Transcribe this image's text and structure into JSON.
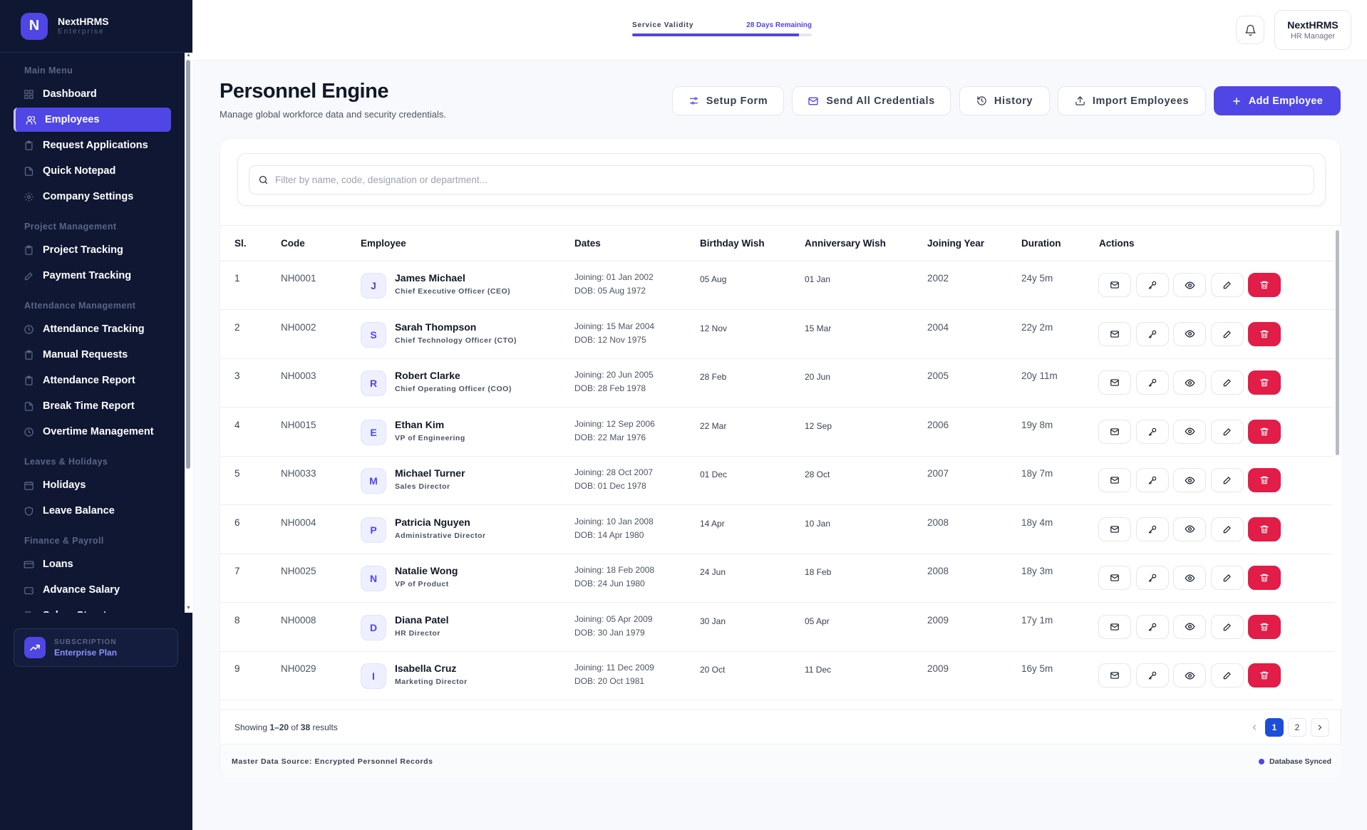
{
  "brand": {
    "initial": "N",
    "name": "NextHRMS",
    "edition": "Enterprise"
  },
  "sidebar": {
    "sections": [
      {
        "title": "Main Menu",
        "items": [
          {
            "label": "Dashboard",
            "icon": "grid-icon",
            "active": false
          },
          {
            "label": "Employees",
            "icon": "users-icon",
            "active": true
          },
          {
            "label": "Request Applications",
            "icon": "clipboard-icon",
            "active": false
          },
          {
            "label": "Quick Notepad",
            "icon": "note-icon",
            "active": false
          },
          {
            "label": "Company Settings",
            "icon": "gear-icon",
            "active": false
          }
        ]
      },
      {
        "title": "Project Management",
        "items": [
          {
            "label": "Project Tracking",
            "icon": "clipboard-icon",
            "active": false
          },
          {
            "label": "Payment Tracking",
            "icon": "pen-icon",
            "active": false
          }
        ]
      },
      {
        "title": "Attendance Management",
        "items": [
          {
            "label": "Attendance Tracking",
            "icon": "clock-icon",
            "active": false
          },
          {
            "label": "Manual Requests",
            "icon": "clipboard-icon",
            "active": false
          },
          {
            "label": "Attendance Report",
            "icon": "clipboard-icon",
            "active": false
          },
          {
            "label": "Break Time Report",
            "icon": "note-icon",
            "active": false
          },
          {
            "label": "Overtime Management",
            "icon": "clock-icon",
            "active": false
          }
        ]
      },
      {
        "title": "Leaves & Holidays",
        "items": [
          {
            "label": "Holidays",
            "icon": "calendar-icon",
            "active": false
          },
          {
            "label": "Leave Balance",
            "icon": "shield-icon",
            "active": false
          }
        ]
      },
      {
        "title": "Finance & Payroll",
        "items": [
          {
            "label": "Loans",
            "icon": "card-icon",
            "active": false
          },
          {
            "label": "Advance Salary",
            "icon": "wallet-icon",
            "active": false
          },
          {
            "label": "Salary Structure",
            "icon": "note-icon",
            "active": false
          }
        ]
      }
    ],
    "subscription": {
      "label": "SUBSCRIPTION",
      "plan": "Enterprise Plan"
    }
  },
  "topbar": {
    "validity_label": "Service Validity",
    "validity_remaining": "28 Days Remaining",
    "validity_fraction": 0.93,
    "user_name": "NextHRMS",
    "user_role": "HR Manager"
  },
  "page": {
    "title": "Personnel Engine",
    "subtitle": "Manage global workforce data and security credentials."
  },
  "toolbar": {
    "setup_form": "Setup Form",
    "send_credentials": "Send All Credentials",
    "history": "History",
    "import": "Import Employees",
    "add": "Add Employee"
  },
  "search": {
    "placeholder": "Filter by name, code, designation or department..."
  },
  "table": {
    "headers": {
      "sl": "Sl.",
      "code": "Code",
      "employee": "Employee",
      "dates": "Dates",
      "birthday": "Birthday Wish",
      "anniversary": "Anniversary Wish",
      "year": "Joining Year",
      "duration": "Duration",
      "actions": "Actions"
    },
    "rows": [
      {
        "sl": "1",
        "code": "NH0001",
        "initial": "J",
        "name": "James Michael",
        "designation": "Chief Executive Officer (CEO)",
        "joining": "Joining: 01 Jan 2002",
        "dob": "DOB: 05 Aug 1972",
        "birthday": "05 Aug",
        "anniversary": "01 Jan",
        "year": "2002",
        "duration": "24y 5m"
      },
      {
        "sl": "2",
        "code": "NH0002",
        "initial": "S",
        "name": "Sarah Thompson",
        "designation": "Chief Technology Officer (CTO)",
        "joining": "Joining: 15 Mar 2004",
        "dob": "DOB: 12 Nov 1975",
        "birthday": "12 Nov",
        "anniversary": "15 Mar",
        "year": "2004",
        "duration": "22y 2m"
      },
      {
        "sl": "3",
        "code": "NH0003",
        "initial": "R",
        "name": "Robert Clarke",
        "designation": "Chief Operating Officer (COO)",
        "joining": "Joining: 20 Jun 2005",
        "dob": "DOB: 28 Feb 1978",
        "birthday": "28 Feb",
        "anniversary": "20 Jun",
        "year": "2005",
        "duration": "20y 11m"
      },
      {
        "sl": "4",
        "code": "NH0015",
        "initial": "E",
        "name": "Ethan Kim",
        "designation": "VP of Engineering",
        "joining": "Joining: 12 Sep 2006",
        "dob": "DOB: 22 Mar 1976",
        "birthday": "22 Mar",
        "anniversary": "12 Sep",
        "year": "2006",
        "duration": "19y 8m"
      },
      {
        "sl": "5",
        "code": "NH0033",
        "initial": "M",
        "name": "Michael Turner",
        "designation": "Sales Director",
        "joining": "Joining: 28 Oct 2007",
        "dob": "DOB: 01 Dec 1978",
        "birthday": "01 Dec",
        "anniversary": "28 Oct",
        "year": "2007",
        "duration": "18y 7m"
      },
      {
        "sl": "6",
        "code": "NH0004",
        "initial": "P",
        "name": "Patricia Nguyen",
        "designation": "Administrative Director",
        "joining": "Joining: 10 Jan 2008",
        "dob": "DOB: 14 Apr 1980",
        "birthday": "14 Apr",
        "anniversary": "10 Jan",
        "year": "2008",
        "duration": "18y 4m"
      },
      {
        "sl": "7",
        "code": "NH0025",
        "initial": "N",
        "name": "Natalie Wong",
        "designation": "VP of Product",
        "joining": "Joining: 18 Feb 2008",
        "dob": "DOB: 24 Jun 1980",
        "birthday": "24 Jun",
        "anniversary": "18 Feb",
        "year": "2008",
        "duration": "18y 3m"
      },
      {
        "sl": "8",
        "code": "NH0008",
        "initial": "D",
        "name": "Diana Patel",
        "designation": "HR Director",
        "joining": "Joining: 05 Apr 2009",
        "dob": "DOB: 30 Jan 1979",
        "birthday": "30 Jan",
        "anniversary": "05 Apr",
        "year": "2009",
        "duration": "17y 1m"
      },
      {
        "sl": "9",
        "code": "NH0029",
        "initial": "I",
        "name": "Isabella Cruz",
        "designation": "Marketing Director",
        "joining": "Joining: 11 Dec 2009",
        "dob": "DOB: 20 Oct 1981",
        "birthday": "20 Oct",
        "anniversary": "11 Dec",
        "year": "2009",
        "duration": "16y 5m"
      }
    ]
  },
  "pagination": {
    "prefix": "Showing ",
    "range": "1–20",
    "mid": " of ",
    "total": "38",
    "suffix": " results",
    "pages": [
      "1",
      "2"
    ],
    "current": "1"
  },
  "footer": {
    "source": "Master Data Source: Encrypted Personnel Records",
    "status": "Database Synced"
  },
  "colors": {
    "accent": "#4f46e5",
    "sidebar": "#0f1733",
    "danger": "#e11d48",
    "page_active": "#1d4ed8"
  }
}
